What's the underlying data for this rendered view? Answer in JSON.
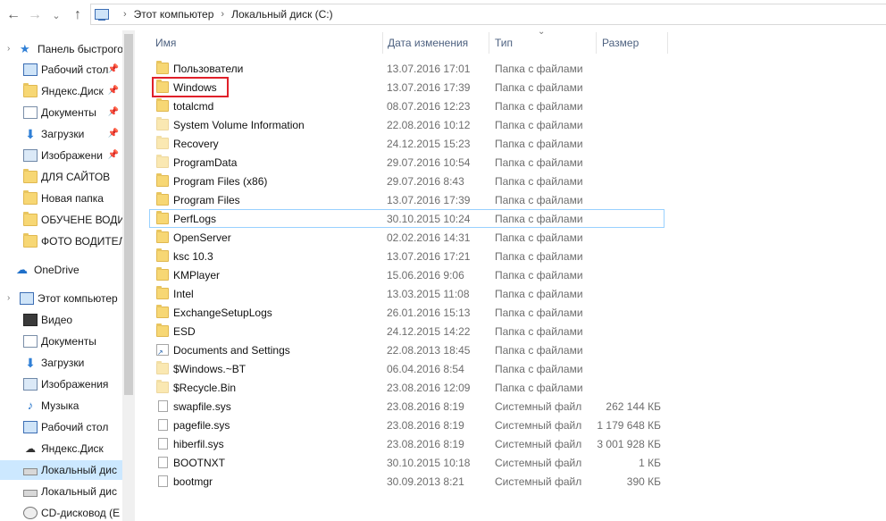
{
  "address": {
    "segments": [
      "Этот компьютер",
      "Локальный диск (C:)"
    ]
  },
  "nav": {
    "back_icon": "←",
    "forward_icon": "→",
    "recent_icon": "⌄",
    "up_icon": "↑"
  },
  "sidebar": {
    "quick_access": "Панель быстрого",
    "items": [
      {
        "label": "Рабочий стол",
        "icon": "monitor"
      },
      {
        "label": "Яндекс.Диск",
        "icon": "folder"
      },
      {
        "label": "Документы",
        "icon": "doc"
      },
      {
        "label": "Загрузки",
        "icon": "download"
      },
      {
        "label": "Изображени",
        "icon": "img"
      },
      {
        "label": "ДЛЯ САЙТОВ",
        "icon": "folder"
      },
      {
        "label": "Новая папка",
        "icon": "folder"
      },
      {
        "label": "ОБУЧЕНЕ ВОДИ",
        "icon": "folder"
      },
      {
        "label": "ФОТО ВОДИТЕЛ",
        "icon": "folder"
      }
    ],
    "onedrive": "OneDrive",
    "this_pc": "Этот компьютер",
    "pc_items": [
      {
        "label": "Видео",
        "icon": "video"
      },
      {
        "label": "Документы",
        "icon": "doc"
      },
      {
        "label": "Загрузки",
        "icon": "download"
      },
      {
        "label": "Изображения",
        "icon": "img"
      },
      {
        "label": "Музыка",
        "icon": "music"
      },
      {
        "label": "Рабочий стол",
        "icon": "monitor"
      },
      {
        "label": "Яндекс.Диск",
        "icon": "yadisk"
      },
      {
        "label": "Локальный дис",
        "icon": "drive"
      },
      {
        "label": "Локальный дис",
        "icon": "drive"
      },
      {
        "label": "CD-дисковод (E",
        "icon": "disc"
      }
    ]
  },
  "columns": {
    "name": "Имя",
    "date": "Дата изменения",
    "type": "Тип",
    "size": "Размер"
  },
  "files": [
    {
      "name": "Пользователи",
      "date": "13.07.2016 17:01",
      "type": "Папка с файлами",
      "size": "",
      "icon": "folder"
    },
    {
      "name": "Windows",
      "date": "13.07.2016 17:39",
      "type": "Папка с файлами",
      "size": "",
      "icon": "folder"
    },
    {
      "name": "totalcmd",
      "date": "08.07.2016 12:23",
      "type": "Папка с файлами",
      "size": "",
      "icon": "folder"
    },
    {
      "name": "System Volume Information",
      "date": "22.08.2016 10:12",
      "type": "Папка с файлами",
      "size": "",
      "icon": "folder-hidden"
    },
    {
      "name": "Recovery",
      "date": "24.12.2015 15:23",
      "type": "Папка с файлами",
      "size": "",
      "icon": "folder-hidden"
    },
    {
      "name": "ProgramData",
      "date": "29.07.2016 10:54",
      "type": "Папка с файлами",
      "size": "",
      "icon": "folder-hidden"
    },
    {
      "name": "Program Files (x86)",
      "date": "29.07.2016 8:43",
      "type": "Папка с файлами",
      "size": "",
      "icon": "folder"
    },
    {
      "name": "Program Files",
      "date": "13.07.2016 17:39",
      "type": "Папка с файлами",
      "size": "",
      "icon": "folder"
    },
    {
      "name": "PerfLogs",
      "date": "30.10.2015 10:24",
      "type": "Папка с файлами",
      "size": "",
      "icon": "folder"
    },
    {
      "name": "OpenServer",
      "date": "02.02.2016 14:31",
      "type": "Папка с файлами",
      "size": "",
      "icon": "folder"
    },
    {
      "name": "ksc 10.3",
      "date": "13.07.2016 17:21",
      "type": "Папка с файлами",
      "size": "",
      "icon": "folder"
    },
    {
      "name": "KMPlayer",
      "date": "15.06.2016 9:06",
      "type": "Папка с файлами",
      "size": "",
      "icon": "folder"
    },
    {
      "name": "Intel",
      "date": "13.03.2015 11:08",
      "type": "Папка с файлами",
      "size": "",
      "icon": "folder"
    },
    {
      "name": "ExchangeSetupLogs",
      "date": "26.01.2016 15:13",
      "type": "Папка с файлами",
      "size": "",
      "icon": "folder"
    },
    {
      "name": "ESD",
      "date": "24.12.2015 14:22",
      "type": "Папка с файлами",
      "size": "",
      "icon": "folder"
    },
    {
      "name": "Documents and Settings",
      "date": "22.08.2013 18:45",
      "type": "Папка с файлами",
      "size": "",
      "icon": "shortcut"
    },
    {
      "name": "$Windows.~BT",
      "date": "06.04.2016 8:54",
      "type": "Папка с файлами",
      "size": "",
      "icon": "folder-hidden"
    },
    {
      "name": "$Recycle.Bin",
      "date": "23.08.2016 12:09",
      "type": "Папка с файлами",
      "size": "",
      "icon": "folder-hidden"
    },
    {
      "name": "swapfile.sys",
      "date": "23.08.2016 8:19",
      "type": "Системный файл",
      "size": "262 144 КБ",
      "icon": "file"
    },
    {
      "name": "pagefile.sys",
      "date": "23.08.2016 8:19",
      "type": "Системный файл",
      "size": "1 179 648 КБ",
      "icon": "file"
    },
    {
      "name": "hiberfil.sys",
      "date": "23.08.2016 8:19",
      "type": "Системный файл",
      "size": "3 001 928 КБ",
      "icon": "file"
    },
    {
      "name": "BOOTNXT",
      "date": "30.10.2015 10:18",
      "type": "Системный файл",
      "size": "1 КБ",
      "icon": "file"
    },
    {
      "name": "bootmgr",
      "date": "30.09.2013 8:21",
      "type": "Системный файл",
      "size": "390 КБ",
      "icon": "file"
    }
  ],
  "hover_row_index": 8,
  "highlighted_row_index": 1,
  "colors": {
    "highlight_border": "#e0202a",
    "hover_border": "#99d1ff",
    "selected_bg": "#cce8ff",
    "header_text": "#4d6180"
  }
}
